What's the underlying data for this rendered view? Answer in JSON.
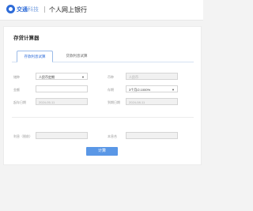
{
  "header": {
    "brand_name": "交通",
    "brand_suffix": "科技",
    "site_title": "个人网上银行"
  },
  "page": {
    "title": "存贷计算器"
  },
  "tabs": [
    {
      "label": "存款利息试算"
    },
    {
      "label": "贷款利息试算"
    }
  ],
  "form": {
    "category_label": "储种",
    "category_value": "人民币定期",
    "currency_label": "币种",
    "currency_value": "人民币",
    "amount_label": "金额",
    "amount_value": "",
    "term_label": "存期",
    "term_value": "3个月/2.1000%",
    "start_date_label": "起存日期",
    "start_date_value": "2024-05-11",
    "end_date_label": "到期日期",
    "end_date_value": "2024-08-11",
    "interest_label": "利息（税前）",
    "interest_value": "",
    "principal_interest_label": "本息合",
    "principal_interest_value": ""
  },
  "actions": {
    "calculate_label": "计算"
  }
}
